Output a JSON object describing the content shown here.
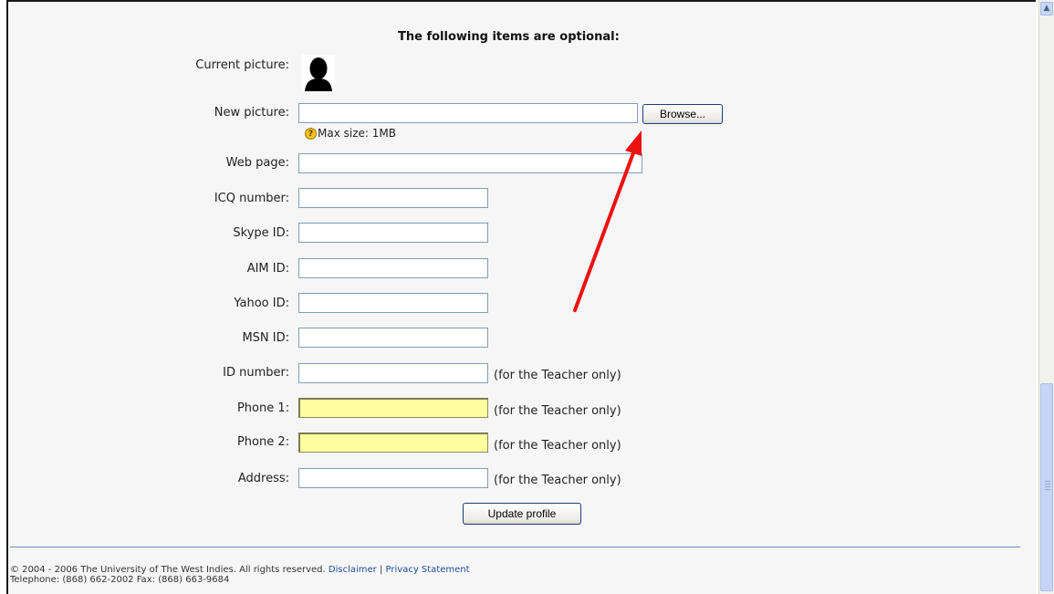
{
  "form": {
    "heading": "The following items are optional:",
    "current_picture_label": "Current picture:",
    "new_picture_label": "New picture:",
    "browse_label": "Browse...",
    "max_size": "Max size: 1MB",
    "web_page_label": "Web page:",
    "icq_label": "ICQ number:",
    "skype_label": "Skype ID:",
    "aim_label": "AIM ID:",
    "yahoo_label": "Yahoo ID:",
    "msn_label": "MSN ID:",
    "id_number_label": "ID number:",
    "phone1_label": "Phone 1:",
    "phone2_label": "Phone 2:",
    "address_label": "Address:",
    "teacher_note": "(for the Teacher only)",
    "submit_label": "Update profile"
  },
  "footer": {
    "copyright": "© 2004 - 2006 The University of The West Indies. All rights reserved.",
    "disclaimer_link": "Disclaimer",
    "separator": "|",
    "privacy_link": "Privacy Statement",
    "contact": "Telephone: (868) 662-2002 Fax: (868) 663-9684"
  },
  "colors": {
    "highlight_field": "#ffffa0",
    "annotation_arrow": "#ee1111",
    "link": "#1f4f9c"
  },
  "icons": {
    "current_picture": "user-silhouette-icon",
    "help": "help-icon",
    "scroll_up": "chevron-up-icon"
  }
}
